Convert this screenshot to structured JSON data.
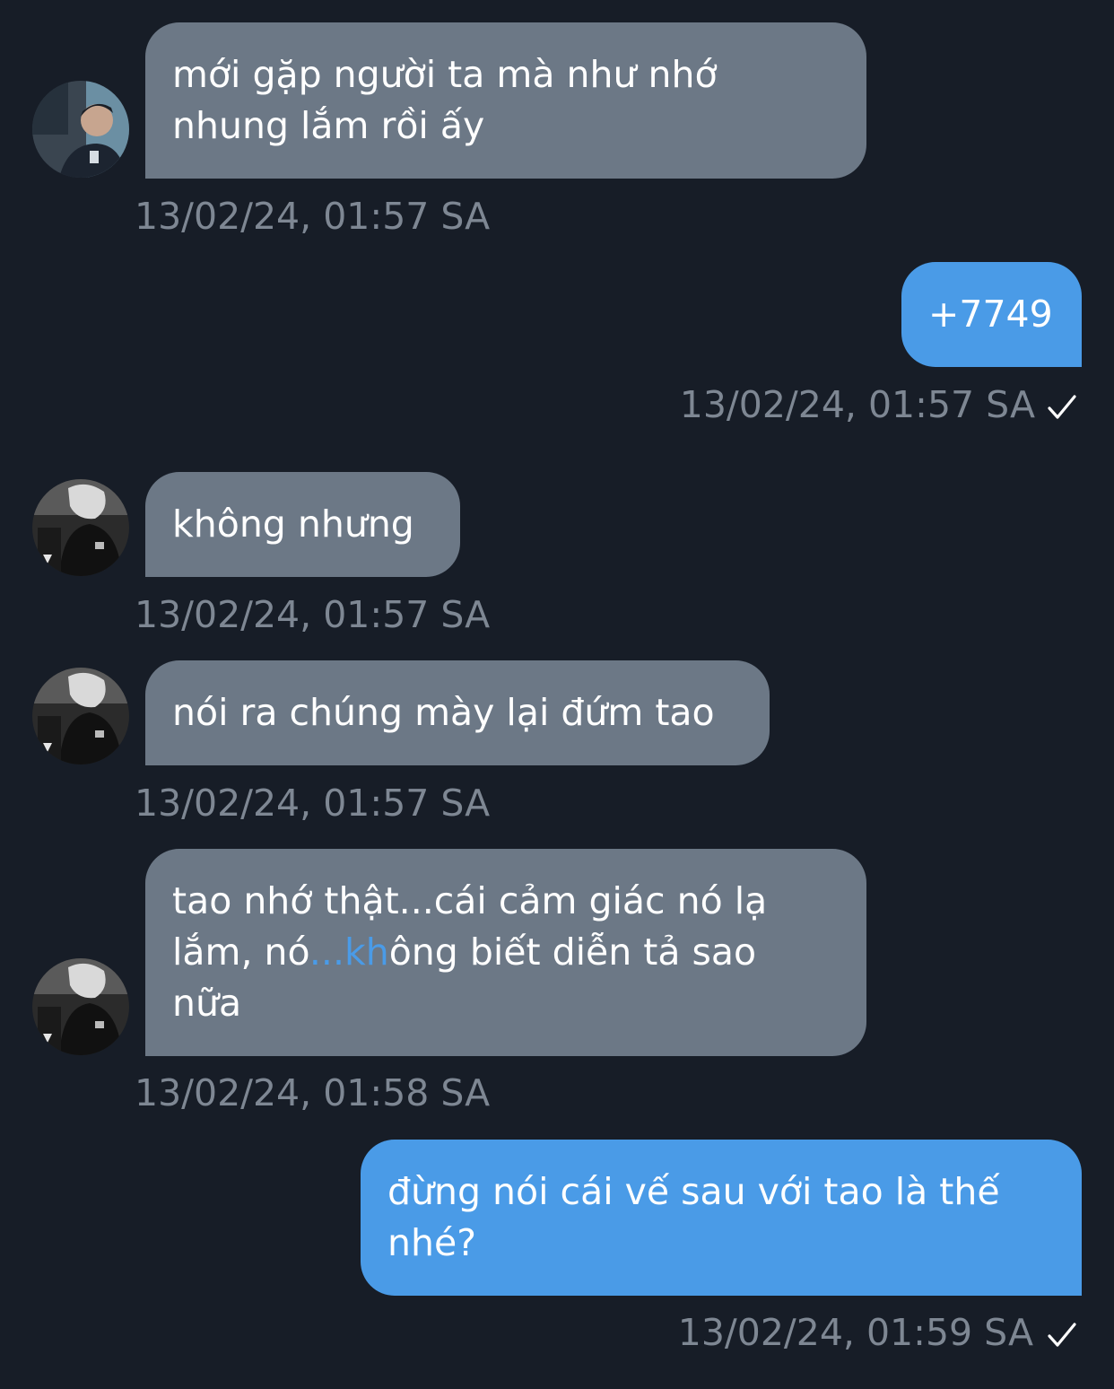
{
  "chat": {
    "messages": [
      {
        "direction": "incoming",
        "text": "mới gặp người ta mà như nhớ\nnhung lắm rồi ấy",
        "time": "13/02/24, 01:57 SA"
      },
      {
        "direction": "outgoing",
        "text": "+7749",
        "time": "13/02/24, 01:57 SA",
        "status": "sent"
      },
      {
        "direction": "incoming",
        "text": "không nhưng",
        "time": "13/02/24, 01:57 SA"
      },
      {
        "direction": "incoming",
        "text": "nói ra chúng mày lại đứm tao",
        "time": "13/02/24, 01:57 SA"
      },
      {
        "direction": "incoming",
        "text_part1": "tao nhớ thật...cái cảm giác nó lạ\nlắm, nó",
        "text_highlight": "...kh",
        "text_part2": "ông biết diễn tả sao\nnữa",
        "time": "13/02/24, 01:58 SA"
      },
      {
        "direction": "outgoing",
        "text": "đừng nói cái vế sau với tao là thế\nnhé?",
        "time": "13/02/24, 01:59 SA",
        "status": "sent"
      }
    ]
  },
  "colors": {
    "background": "#171d27",
    "incoming_bubble": "#6c7886",
    "outgoing_bubble": "#4a9be7",
    "timestamp": "#7e8793",
    "highlight_text": "#4a9be7"
  },
  "icons": {
    "avatar_1": "avatar-photo-blue",
    "avatar_2": "avatar-photo-monochrome",
    "status": "checkmark-icon"
  }
}
